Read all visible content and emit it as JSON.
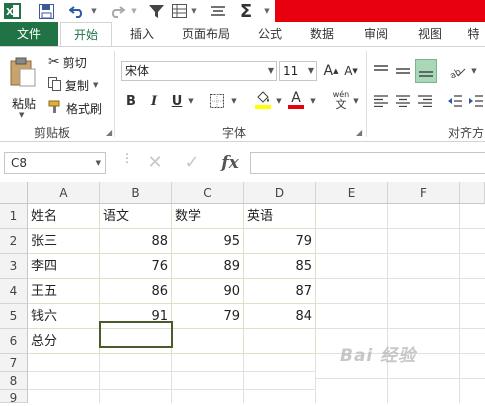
{
  "quick_access": {
    "app_icon": "excel-icon",
    "save_icon": "save-icon",
    "undo_icon": "undo-icon",
    "redo_icon": "redo-icon",
    "filter_icon": "filter-icon",
    "form_icon": "form-icon",
    "align_icon": "align-icon",
    "sum_icon": "sigma-icon",
    "sum_glyph": "Σ",
    "excel_glyph": "X"
  },
  "brand_colors": {
    "excel_green": "#217346",
    "title_red": "#e8000e"
  },
  "tabs": [
    {
      "label": "文件"
    },
    {
      "label": "开始"
    },
    {
      "label": "插入"
    },
    {
      "label": "页面布局"
    },
    {
      "label": "公式"
    },
    {
      "label": "数据"
    },
    {
      "label": "审阅"
    },
    {
      "label": "视图"
    },
    {
      "label": "特"
    }
  ],
  "ribbon": {
    "clipboard": {
      "paste": "粘贴",
      "cut": "剪切",
      "copy": "复制",
      "format_painter": "格式刷",
      "group_label": "剪贴板"
    },
    "font": {
      "font_name": "宋体",
      "font_size": "11",
      "grow": "A",
      "shrink": "A",
      "bold": "B",
      "italic": "I",
      "underline": "U",
      "font_color": "A",
      "phonetic": "wén",
      "group_label": "字体"
    },
    "alignment": {
      "group_label": "对齐方"
    }
  },
  "formula_bar": {
    "name_box": "C8",
    "cancel": "✕",
    "enter": "✓",
    "fx": "fx",
    "value": ""
  },
  "sheet": {
    "columns": [
      "A",
      "B",
      "C",
      "D",
      "E",
      "F"
    ],
    "rows": [
      "1",
      "2",
      "3",
      "4",
      "5",
      "6",
      "7",
      "8",
      "9"
    ],
    "cells": [
      [
        "姓名",
        "语文",
        "数学",
        "英语"
      ],
      [
        "张三",
        "88",
        "95",
        "79"
      ],
      [
        "李四",
        "76",
        "89",
        "85"
      ],
      [
        "王五",
        "86",
        "90",
        "87"
      ],
      [
        "钱六",
        "91",
        "79",
        "84"
      ],
      [
        "总分",
        "",
        "",
        ""
      ]
    ]
  },
  "watermark": "Bai 经验"
}
